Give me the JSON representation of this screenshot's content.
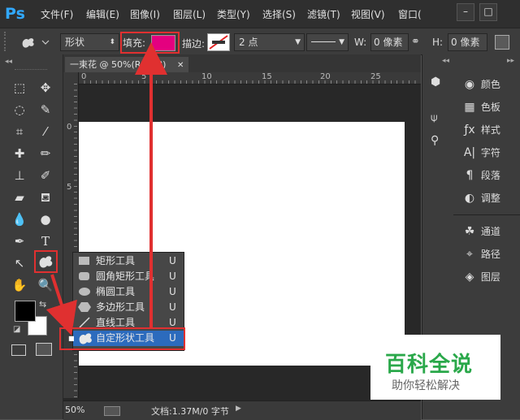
{
  "app": {
    "logo": "Ps"
  },
  "menubar": {
    "items": [
      "文件(F)",
      "编辑(E)",
      "图像(I)",
      "图层(L)",
      "类型(Y)",
      "选择(S)",
      "滤镜(T)",
      "视图(V)",
      "窗口("
    ],
    "window_controls": [
      "–",
      "□"
    ]
  },
  "options": {
    "mode": "形状",
    "fill_label": "填充:",
    "fill_color": "#e4007f",
    "stroke_label": "描边:",
    "stroke_width": "2 点",
    "w_label": "W:",
    "w_value": "0 像素",
    "h_label": "H:",
    "h_value": "0 像素"
  },
  "document": {
    "tab_title": "一束花 @ 50%(RGB/8)",
    "ruler_h": [
      "0",
      "5",
      "10",
      "15",
      "20",
      "25"
    ],
    "ruler_v": [
      "0",
      "5"
    ],
    "zoom": "50%",
    "doc_info": "文档:1.37M/0 字节"
  },
  "flyout": {
    "items": [
      {
        "label": "矩形工具",
        "key": "U",
        "icon": "rectangle-icon"
      },
      {
        "label": "圆角矩形工具",
        "key": "U",
        "icon": "rounded-rectangle-icon"
      },
      {
        "label": "椭圆工具",
        "key": "U",
        "icon": "ellipse-icon"
      },
      {
        "label": "多边形工具",
        "key": "U",
        "icon": "polygon-icon"
      },
      {
        "label": "直线工具",
        "key": "U",
        "icon": "line-icon"
      },
      {
        "label": "自定形状工具",
        "key": "U",
        "icon": "custom-shape-icon"
      }
    ]
  },
  "panels": {
    "group1": [
      {
        "label": "颜色",
        "icon": "palette-icon"
      },
      {
        "label": "色板",
        "icon": "swatches-icon"
      },
      {
        "label": "样式",
        "icon": "styles-icon"
      },
      {
        "label": "字符",
        "icon": "character-icon"
      },
      {
        "label": "段落",
        "icon": "paragraph-icon"
      },
      {
        "label": "调整",
        "icon": "adjustments-icon"
      }
    ],
    "group2": [
      {
        "label": "通道",
        "icon": "channels-icon"
      },
      {
        "label": "路径",
        "icon": "paths-icon"
      },
      {
        "label": "图层",
        "icon": "layers-icon"
      }
    ]
  },
  "watermark": {
    "title": "百科全说",
    "subtitle": "助你轻松解决"
  },
  "colors": {
    "accent_red": "#e03030",
    "fill_magenta": "#e4007f",
    "canvas": "#ffffff"
  }
}
